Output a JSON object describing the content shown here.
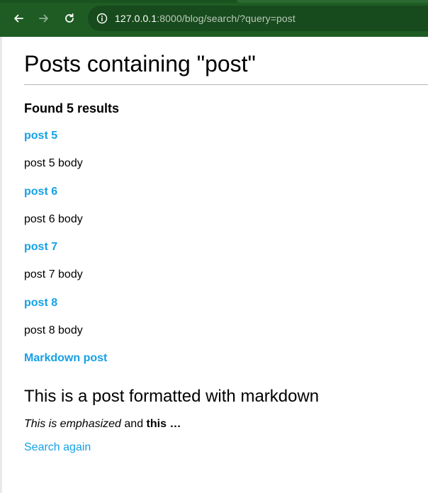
{
  "browser": {
    "url_host": "127.0.0.1",
    "url_rest": ":8000/blog/search/?query=post",
    "theme_color": "#1e5c24",
    "icons": [
      "back-arrow-icon",
      "forward-arrow-icon",
      "reload-icon",
      "info-icon"
    ]
  },
  "page": {
    "title": "Posts containing \"post\"",
    "results_summary": "Found 5 results",
    "link_color": "#15a1e6",
    "results": [
      {
        "title": "post 5",
        "body": "post 5 body"
      },
      {
        "title": "post 6",
        "body": "post 6 body"
      },
      {
        "title": "post 7",
        "body": "post 7 body"
      },
      {
        "title": "post 8",
        "body": "post 8 body"
      },
      {
        "title": "Markdown post",
        "body_heading": "This is a post formatted with markdown",
        "body_emphasis": "This is emphasized",
        "body_connector": " and ",
        "body_strong": "this …"
      }
    ],
    "search_again": "Search again"
  }
}
